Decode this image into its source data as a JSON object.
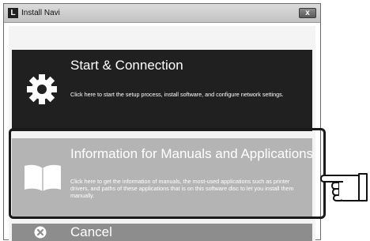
{
  "window": {
    "icon_letter": "L",
    "title": "Install Navi",
    "close_label": "x"
  },
  "menu": {
    "start": {
      "title": "Start & Connection",
      "description": "Click here to start the setup process, install software, and configure network settings.",
      "icon": "gear-icon"
    },
    "info": {
      "title": "Information for Manuals and Applications",
      "description": "Click here to get the information of manuals, the most-used applications such as printer drivers, and paths of these applications that is on this software disc to let you install them manually.",
      "icon": "open-book-icon"
    },
    "cancel": {
      "title": "Cancel",
      "icon": "close-circle-icon"
    }
  },
  "colors": {
    "start_bg": "#202020",
    "info_bg": "#b4b4b4",
    "cancel_bg": "#8d8d8d",
    "highlight": "#1a1a1a"
  }
}
